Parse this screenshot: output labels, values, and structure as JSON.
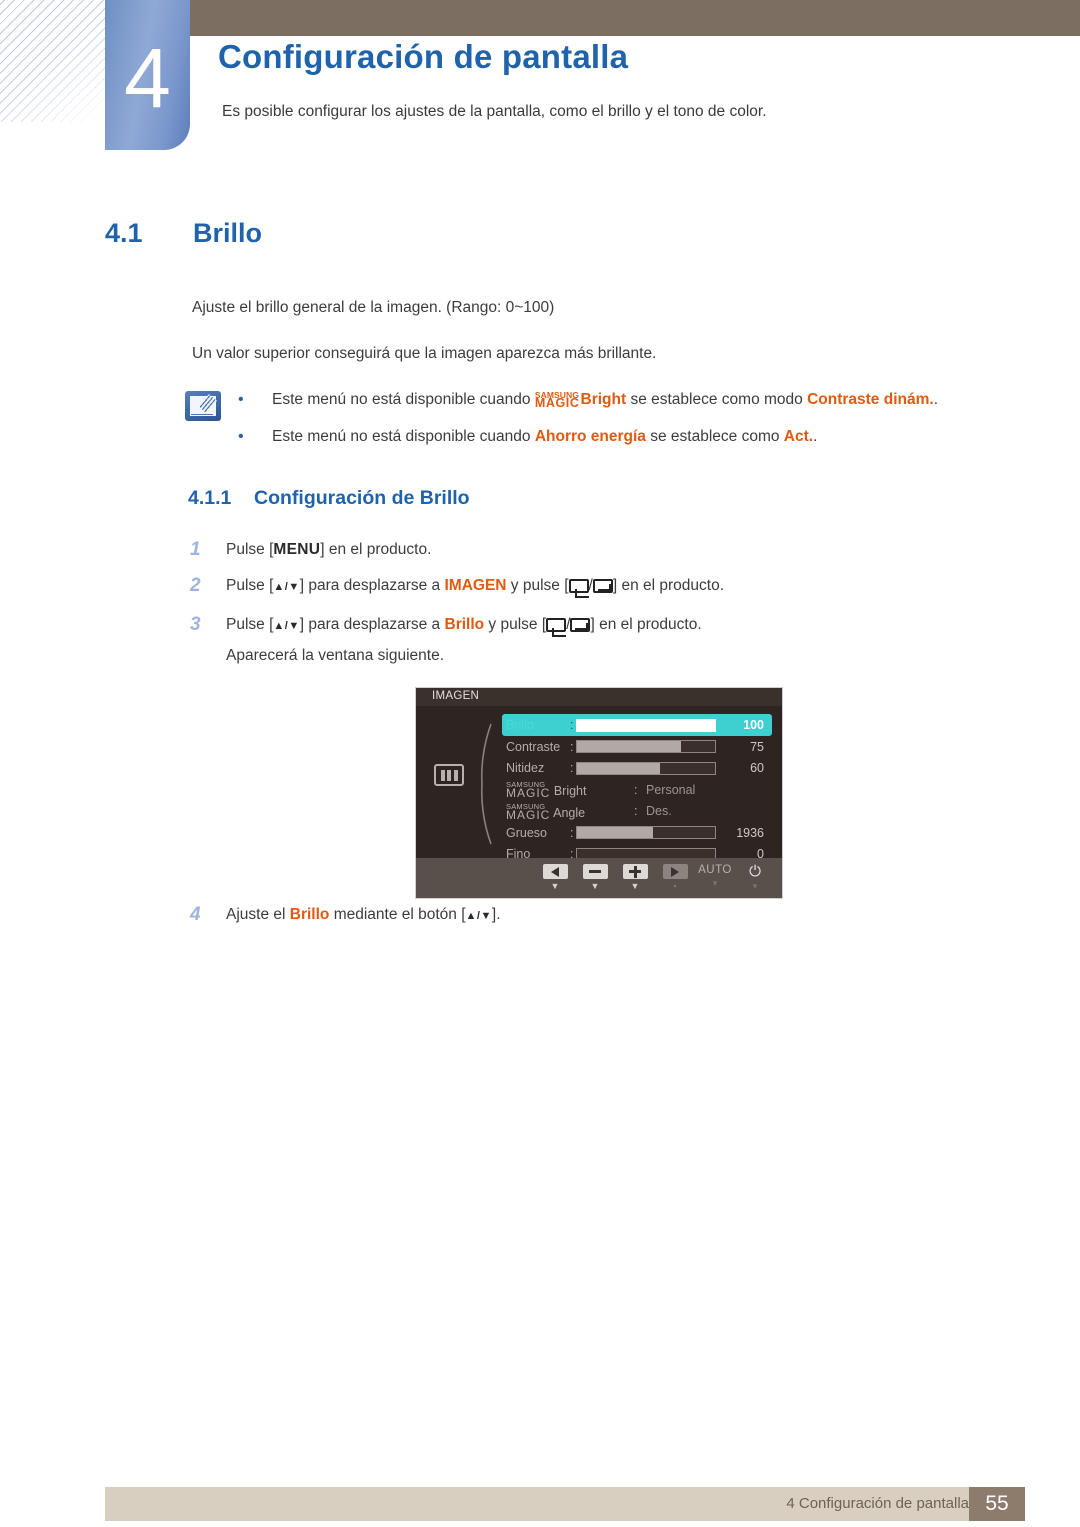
{
  "header": {
    "chapter_number": "4",
    "chapter_title": "Configuración de pantalla",
    "chapter_subtitle": "Es posible configurar los ajustes de la pantalla, como el brillo y el tono de color."
  },
  "section": {
    "number": "4.1",
    "title": "Brillo",
    "paragraph1": "Ajuste el brillo general de la imagen. (Rango: 0~100)",
    "paragraph2": "Un valor superior conseguirá que la imagen aparezca más brillante."
  },
  "note": {
    "icon": "note-pencil-icon",
    "bullet": "•",
    "items": [
      {
        "prefix": "Este menú no está disponible cuando ",
        "magic_top": "SAMSUNG",
        "magic_bottom": "MAGIC",
        "magic_suffix": "Bright",
        "middle": " se establece como modo ",
        "highlight": "Contraste dinám.",
        "suffix": "."
      },
      {
        "prefix": "Este menú no está disponible cuando ",
        "highlight1": "Ahorro energía",
        "middle": " se establece como ",
        "highlight2": "Act.",
        "suffix": "."
      }
    ]
  },
  "subsection": {
    "number": "4.1.1",
    "title": "Configuración de Brillo"
  },
  "steps": [
    {
      "num": "1",
      "parts": [
        "Pulse [",
        "MENU",
        "] en el producto."
      ]
    },
    {
      "num": "2",
      "p1": "Pulse [",
      "arrows": "▲/▼",
      "p2": "] para desplazarse a ",
      "target": "IMAGEN",
      "p3": " y pulse [",
      "p4": "/",
      "p5": "] en el producto."
    },
    {
      "num": "3",
      "p1": "Pulse [",
      "arrows": "▲/▼",
      "p2": "] para desplazarse a ",
      "target": "Brillo",
      "p3": " y pulse [",
      "p4": "/",
      "p5": "] en el producto.",
      "subnote": "Aparecerá la ventana siguiente."
    },
    {
      "num": "4",
      "p1": "Ajuste el ",
      "target": "Brillo",
      "p2": " mediante el botón [",
      "arrows": "▲/▼",
      "p3": "]."
    }
  ],
  "osd": {
    "title": "IMAGEN",
    "side_icon": "picture-mode-icon",
    "rows": [
      {
        "label": "Brillo",
        "type": "bar",
        "value": "100",
        "fill_pct": 100,
        "selected": true
      },
      {
        "label": "Contraste",
        "type": "bar",
        "value": "75",
        "fill_pct": 75,
        "selected": false
      },
      {
        "label": "Nitidez",
        "type": "bar",
        "value": "60",
        "fill_pct": 60,
        "selected": false
      },
      {
        "label_magic_top": "SAMSUNG",
        "label_magic_bottom": "MAGIC",
        "label_suffix": "Bright",
        "type": "text",
        "value": "Personal",
        "selected": false
      },
      {
        "label_magic_top": "SAMSUNG",
        "label_magic_bottom": "MAGIC",
        "label_suffix": "Angle",
        "type": "text",
        "value": "Des.",
        "selected": false
      },
      {
        "label": "Grueso",
        "type": "bar",
        "value": "1936",
        "fill_pct": 55,
        "selected": false
      },
      {
        "label": "Fino",
        "type": "bar",
        "value": "0",
        "fill_pct": 0,
        "selected": false
      }
    ],
    "colon": ":",
    "buttons": [
      {
        "icon": "left-arrow-icon",
        "caption": "▼",
        "dim": false
      },
      {
        "icon": "minus-icon",
        "caption": "▼",
        "dim": false
      },
      {
        "icon": "plus-icon",
        "caption": "▼",
        "dim": false
      },
      {
        "icon": "right-arrow-icon",
        "caption": "▪",
        "dim": true
      },
      {
        "icon": "auto-label",
        "label": "AUTO",
        "caption": "▾",
        "dim": true
      },
      {
        "icon": "power-icon",
        "glyph": "⏻",
        "caption": "▾",
        "dim": true
      }
    ]
  },
  "footer": {
    "text": "4 Configuración de pantalla",
    "page": "55"
  },
  "colors": {
    "heading_blue": "#1f63ad",
    "accent_orange": "#e05a10",
    "brown_bar": "#7c6e60",
    "footer_bg": "#d9cfc0",
    "page_badge": "#8d7c6c",
    "osd_highlight": "#3ed0d0"
  }
}
